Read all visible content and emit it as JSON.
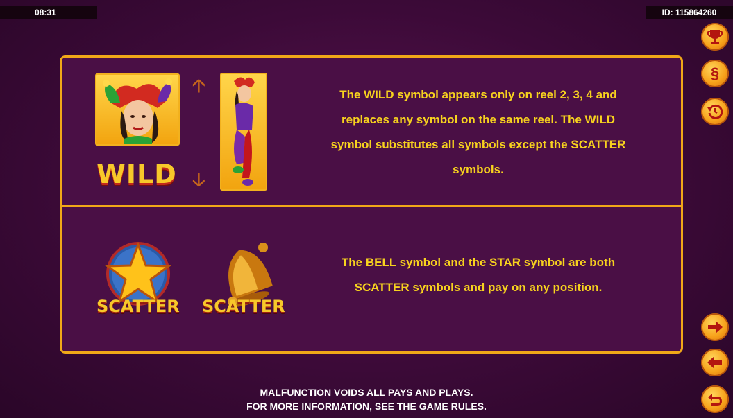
{
  "status": {
    "time": "08:31",
    "id": "ID: 115864260"
  },
  "wild_section": {
    "label": "WILD",
    "description": "The WILD symbol appears only on reel 2, 3, 4 and\nreplaces any symbol on the same reel. The WILD\nsymbol substitutes all symbols except the SCATTER\nsymbols."
  },
  "scatter_section": {
    "star_label": "SCATTER",
    "bell_label": "SCATTER",
    "description": "The BELL symbol and the STAR symbol are both\nSCATTER symbols and pay on any position."
  },
  "footer": {
    "line1": "MALFUNCTION VOIDS ALL PAYS AND PLAYS.",
    "line2": "FOR MORE INFORMATION, SEE THE GAME RULES."
  },
  "side_buttons": {
    "trophy": "trophy-icon",
    "rules": "§",
    "history": "history-icon",
    "next": "arrow-right-icon",
    "prev": "arrow-left-icon",
    "back": "return-icon"
  },
  "colors": {
    "accent": "#f0a818",
    "text": "#f7d21e",
    "background": "#3c0a38"
  }
}
